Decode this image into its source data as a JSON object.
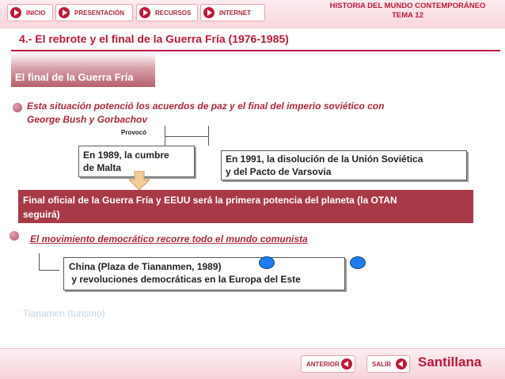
{
  "nav": {
    "items": [
      {
        "label": "INICIO"
      },
      {
        "label": "PRESENTACIÓN"
      },
      {
        "label": "RECURSOS"
      },
      {
        "label": "INTERNET"
      }
    ],
    "course_line1": "HISTORIA DEL MUNDO CONTEMPORÁNEO",
    "course_line2": "TEMA 12"
  },
  "page": {
    "title": "4.- El rebrote y el final de la Guerra Fría (1976-1985)",
    "section_label": "El final de la Guerra Fría"
  },
  "bullet1": {
    "line1": "Esta situación potenció los acuerdos de paz  y el final del imperio soviético con",
    "line2": "George Bush y Gorbachov",
    "caption": "Provocó"
  },
  "box_malta": {
    "line1": "En 1989, la cumbre",
    "line2": "de Malta"
  },
  "box_ussr": {
    "line1": "En 1991, la disolución de la Unión Soviética",
    "line2": "y del Pacto de Varsovia"
  },
  "banner": {
    "line1": "Final oficial de la Guerra Fría y EEUU será la primera potencia del planeta (la OTAN",
    "line2": "seguirá)"
  },
  "bullet2": {
    "text": "El movimiento democrático recorre todo el mundo comunista"
  },
  "box_china": {
    "line1": "China (Plaza de Tiananmen, 1989)",
    "line2": " y revoluciones democráticas en la Europa del Este"
  },
  "link": {
    "label": "Tianamen (turismo)"
  },
  "footer": {
    "prev_label": "ANTERIOR",
    "exit_label": "SALIR",
    "brand": "Santillana"
  },
  "colors": {
    "brand_red": "#c0173a",
    "banner": "#a83a47",
    "circle_blue": "#1e7bf0"
  }
}
